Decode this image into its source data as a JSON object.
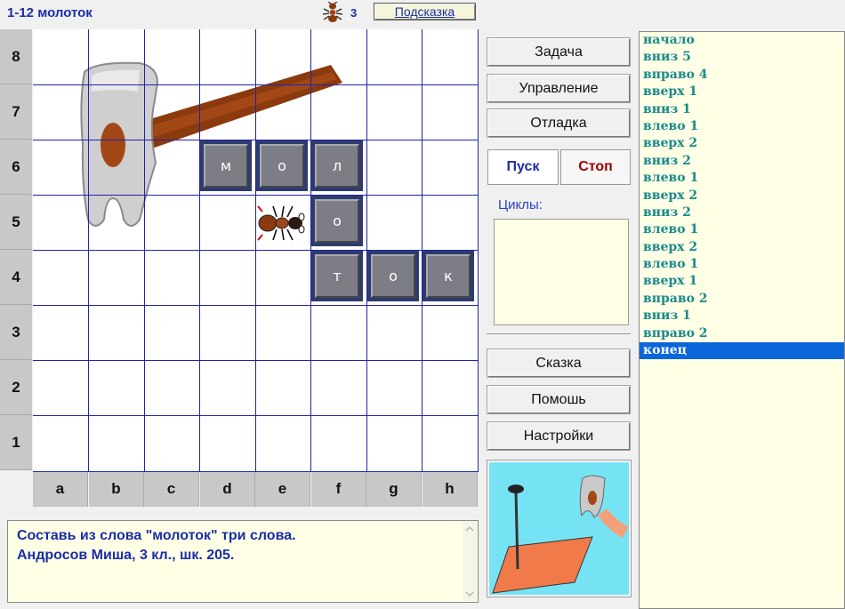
{
  "header": {
    "title": "1-12 молоток",
    "ant_count": "3",
    "hint_label": "Подсказка"
  },
  "board": {
    "row_labels": [
      "8",
      "7",
      "6",
      "5",
      "4",
      "3",
      "2",
      "1"
    ],
    "col_labels": [
      "a",
      "b",
      "c",
      "d",
      "e",
      "f",
      "g",
      "h"
    ],
    "tiles": [
      {
        "letter": "м",
        "cell": "d6"
      },
      {
        "letter": "о",
        "cell": "e6"
      },
      {
        "letter": "л",
        "cell": "f6"
      },
      {
        "letter": "о",
        "cell": "f5"
      },
      {
        "letter": "т",
        "cell": "f4"
      },
      {
        "letter": "о",
        "cell": "g4"
      },
      {
        "letter": "к",
        "cell": "h4"
      }
    ],
    "ant_cell": "e5"
  },
  "menu": {
    "task": "Задача",
    "control": "Управление",
    "debug": "Отладка",
    "run": "Пуск",
    "stop": "Стоп",
    "cycles_label": "Циклы:",
    "tale": "Сказка",
    "help": "Помошь",
    "settings": "Настройки"
  },
  "program": [
    "начало",
    "вниз 5",
    "вправо 4",
    "вверх 1",
    "вниз 1",
    "влево 1",
    "вверх 2",
    "вниз 2",
    "влево 1",
    "вверх 2",
    "вниз 2",
    "влево 1",
    "вверх 2",
    "влево 1",
    "вверх 1",
    "вправо 2",
    "вниз 1",
    "вправо 2",
    "конец"
  ],
  "program_selected_index": 18,
  "status": {
    "line1": "Составь из слова \"молоток\" три слова.",
    "line2": "Андросов Миша, 3 кл., шк. 205."
  },
  "colors": {
    "accent": "#1a2ea8",
    "stop": "#a00000",
    "program_text": "#1a8a8a",
    "selection": "#0a66d9",
    "panel_bg": "#ffffe6"
  }
}
